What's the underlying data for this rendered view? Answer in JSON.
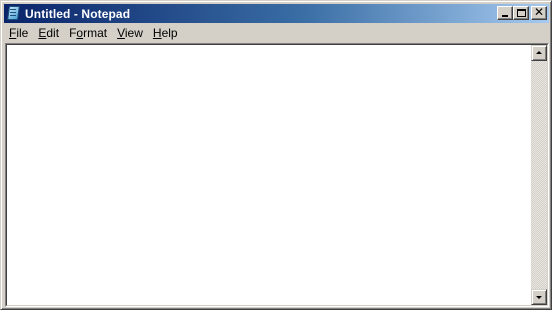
{
  "window": {
    "title": "Untitled - Notepad",
    "icon": "notepad-icon"
  },
  "controls": {
    "minimize_icon": "minimize-icon",
    "maximize_icon": "maximize-icon",
    "close_icon": "close-icon",
    "close_glyph": "✕"
  },
  "menu": {
    "items": [
      {
        "accel": "F",
        "rest": "ile"
      },
      {
        "accel": "E",
        "rest": "dit"
      },
      {
        "accel": "o",
        "prefix": "F",
        "rest": "rmat"
      },
      {
        "accel": "V",
        "rest": "iew"
      },
      {
        "accel": "H",
        "rest": "elp"
      }
    ]
  },
  "editor": {
    "content": ""
  },
  "colors": {
    "titlebar_start": "#0a246a",
    "titlebar_end": "#a6caf0",
    "chrome": "#d4d0c8",
    "editor_bg": "#ffffff"
  }
}
